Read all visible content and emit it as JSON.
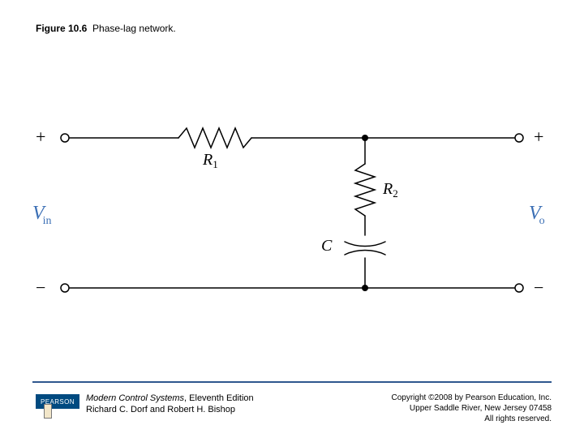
{
  "caption": {
    "fig_no": "Figure 10.6",
    "title": "Phase-lag network."
  },
  "labels": {
    "Vin": "V",
    "Vin_sub": "in",
    "Vo": "V",
    "Vo_sub": "o",
    "R1": "R",
    "R1_sub": "1",
    "R2": "R",
    "R2_sub": "2",
    "C": "C",
    "plus": "+",
    "minus": "−"
  },
  "footer": {
    "brand": "PEARSON",
    "book_title": "Modern Control Systems",
    "edition": ", Eleventh Edition",
    "authors": "Richard C. Dorf and Robert H. Bishop",
    "copyright_line1": "Copyright ©2008 by Pearson Education, Inc.",
    "copyright_line2": "Upper Saddle River, New Jersey 07458",
    "copyright_line3": "All rights reserved."
  },
  "circuit": {
    "description": "Two-port phase-lag network: series resistor R1 from input+ to output+, with shunt branch R2 in series with capacitor C from the output node down to the common (bottom) rail. Input port on left, output port on right.",
    "components": [
      {
        "ref": "R1",
        "type": "resistor",
        "orientation": "horizontal",
        "between": [
          "in+",
          "node_top"
        ]
      },
      {
        "ref": "R2",
        "type": "resistor",
        "orientation": "vertical",
        "between": [
          "node_top",
          "node_cap"
        ]
      },
      {
        "ref": "C",
        "type": "capacitor",
        "orientation": "vertical",
        "between": [
          "node_cap",
          "rail_bottom"
        ]
      }
    ],
    "ports": {
      "input": [
        "in+",
        "in-"
      ],
      "output": [
        "out+",
        "out-"
      ]
    }
  }
}
